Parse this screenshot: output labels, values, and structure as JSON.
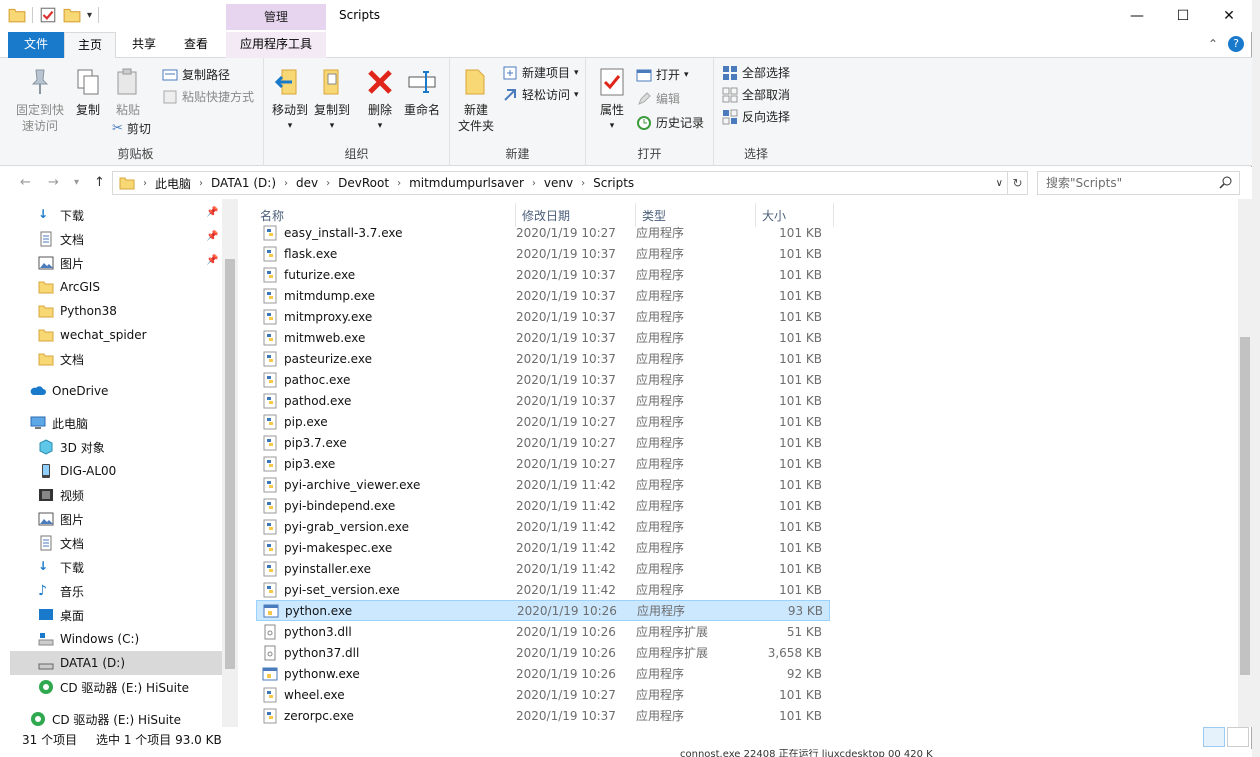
{
  "window": {
    "title": "Scripts",
    "context_group": "管理"
  },
  "tabs": {
    "file": "文件",
    "home": "主页",
    "share": "共享",
    "view": "查看",
    "apptools": "应用程序工具"
  },
  "ribbon": {
    "clipboard": {
      "label": "剪贴板",
      "pin": "固定到快\n速访问",
      "copy": "复制",
      "paste": "粘贴",
      "copy_path": "复制路径",
      "paste_shortcut": "粘贴快捷方式",
      "cut": "剪切"
    },
    "organize": {
      "label": "组织",
      "move_to": "移动到",
      "copy_to": "复制到",
      "delete": "删除",
      "rename": "重命名"
    },
    "new": {
      "label": "新建",
      "new_folder": "新建\n文件夹",
      "new_item": "新建项目",
      "easy_access": "轻松访问"
    },
    "open": {
      "label": "打开",
      "properties": "属性",
      "open": "打开",
      "edit": "编辑",
      "history": "历史记录"
    },
    "select": {
      "label": "选择",
      "select_all": "全部选择",
      "select_none": "全部取消",
      "invert": "反向选择"
    }
  },
  "address": {
    "crumbs": [
      "此电脑",
      "DATA1 (D:)",
      "dev",
      "DevRoot",
      "mitmdumpurlsaver",
      "venv",
      "Scripts"
    ],
    "search_placeholder": "搜索\"Scripts\""
  },
  "nav": {
    "items": [
      "下载",
      "文档",
      "图片",
      "ArcGIS",
      "Python38",
      "wechat_spider",
      "文档",
      "OneDrive",
      "此电脑",
      "3D 对象",
      "DIG-AL00",
      "视频",
      "图片",
      "文档",
      "下载",
      "音乐",
      "桌面",
      "Windows (C:)",
      "DATA1 (D:)",
      "CD 驱动器 (E:) HiSuite",
      "CD 驱动器 (E:) HiSuite"
    ]
  },
  "columns": {
    "name": "名称",
    "date": "修改日期",
    "type": "类型",
    "size": "大小"
  },
  "files": [
    {
      "name": "easy_install-3.7.exe",
      "date": "2020/1/19 10:27",
      "type": "应用程序",
      "size": "101 KB"
    },
    {
      "name": "flask.exe",
      "date": "2020/1/19 10:37",
      "type": "应用程序",
      "size": "101 KB"
    },
    {
      "name": "futurize.exe",
      "date": "2020/1/19 10:37",
      "type": "应用程序",
      "size": "101 KB"
    },
    {
      "name": "mitmdump.exe",
      "date": "2020/1/19 10:37",
      "type": "应用程序",
      "size": "101 KB"
    },
    {
      "name": "mitmproxy.exe",
      "date": "2020/1/19 10:37",
      "type": "应用程序",
      "size": "101 KB"
    },
    {
      "name": "mitmweb.exe",
      "date": "2020/1/19 10:37",
      "type": "应用程序",
      "size": "101 KB"
    },
    {
      "name": "pasteurize.exe",
      "date": "2020/1/19 10:37",
      "type": "应用程序",
      "size": "101 KB"
    },
    {
      "name": "pathoc.exe",
      "date": "2020/1/19 10:37",
      "type": "应用程序",
      "size": "101 KB"
    },
    {
      "name": "pathod.exe",
      "date": "2020/1/19 10:37",
      "type": "应用程序",
      "size": "101 KB"
    },
    {
      "name": "pip.exe",
      "date": "2020/1/19 10:27",
      "type": "应用程序",
      "size": "101 KB"
    },
    {
      "name": "pip3.7.exe",
      "date": "2020/1/19 10:27",
      "type": "应用程序",
      "size": "101 KB"
    },
    {
      "name": "pip3.exe",
      "date": "2020/1/19 10:27",
      "type": "应用程序",
      "size": "101 KB"
    },
    {
      "name": "pyi-archive_viewer.exe",
      "date": "2020/1/19 11:42",
      "type": "应用程序",
      "size": "101 KB"
    },
    {
      "name": "pyi-bindepend.exe",
      "date": "2020/1/19 11:42",
      "type": "应用程序",
      "size": "101 KB"
    },
    {
      "name": "pyi-grab_version.exe",
      "date": "2020/1/19 11:42",
      "type": "应用程序",
      "size": "101 KB"
    },
    {
      "name": "pyi-makespec.exe",
      "date": "2020/1/19 11:42",
      "type": "应用程序",
      "size": "101 KB"
    },
    {
      "name": "pyinstaller.exe",
      "date": "2020/1/19 11:42",
      "type": "应用程序",
      "size": "101 KB"
    },
    {
      "name": "pyi-set_version.exe",
      "date": "2020/1/19 11:42",
      "type": "应用程序",
      "size": "101 KB"
    },
    {
      "name": "python.exe",
      "date": "2020/1/19 10:26",
      "type": "应用程序",
      "size": "93 KB"
    },
    {
      "name": "python3.dll",
      "date": "2020/1/19 10:26",
      "type": "应用程序扩展",
      "size": "51 KB"
    },
    {
      "name": "python37.dll",
      "date": "2020/1/19 10:26",
      "type": "应用程序扩展",
      "size": "3,658 KB"
    },
    {
      "name": "pythonw.exe",
      "date": "2020/1/19 10:26",
      "type": "应用程序",
      "size": "92 KB"
    },
    {
      "name": "wheel.exe",
      "date": "2020/1/19 10:27",
      "type": "应用程序",
      "size": "101 KB"
    },
    {
      "name": "zerorpc.exe",
      "date": "2020/1/19 10:37",
      "type": "应用程序",
      "size": "101 KB"
    }
  ],
  "status": {
    "count": "31 个项目",
    "selected": "选中 1 个项目  93.0 KB"
  },
  "background_peek": {
    "text": "connost.exe    22408    正在运行    liuxcdesktop    00    420 K"
  }
}
